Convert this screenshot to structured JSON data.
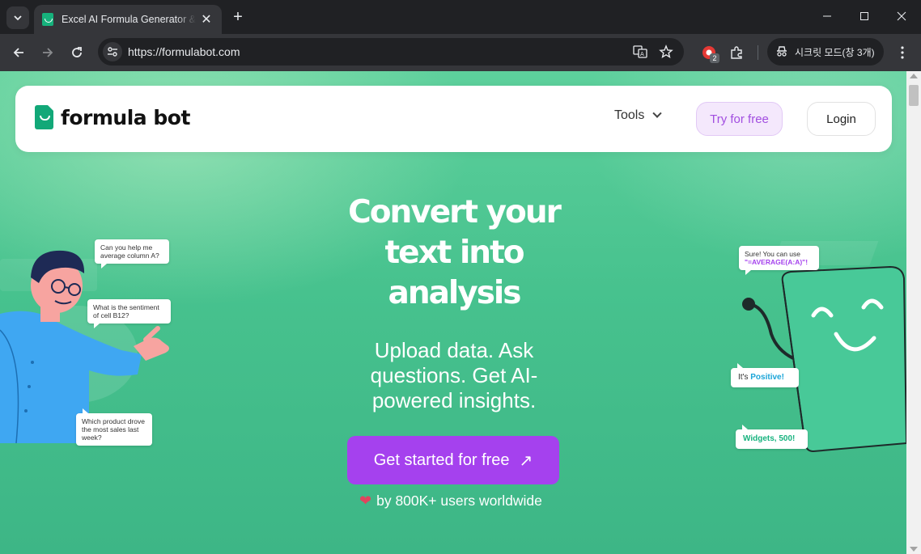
{
  "browser": {
    "tab_title": "Excel AI Formula Generator & ...",
    "url": "https://formulabot.com",
    "incognito_label": "시크릿 모드(창 3개)",
    "extension_badge": "2"
  },
  "nav": {
    "logo_text": "formula bot",
    "tools_label": "Tools",
    "try_label": "Try for free",
    "login_label": "Login"
  },
  "hero": {
    "title_line1": "Convert your",
    "title_line2": "text into",
    "title_line3": "analysis",
    "subtitle": "Upload data. Ask questions. Get AI-powered insights.",
    "cta_label": "Get started for free",
    "social_proof": "by 800K+ users worldwide"
  },
  "left_bubbles": {
    "b1": "Can you help me average column A?",
    "b2": "What is the sentiment of cell B12?",
    "b3": "Which product drove the most sales last week?"
  },
  "right_bubbles": {
    "r1_prefix": "Sure! You can use",
    "r1_formula": "\"=AVERAGE(A:A)\"!",
    "r2_prefix": "It's",
    "r2_value": "Positive!",
    "r3": "Widgets, 500!"
  },
  "colors": {
    "brand_green": "#12a878",
    "cta_purple": "#a541ee",
    "hero_bg": "#47c28e"
  }
}
